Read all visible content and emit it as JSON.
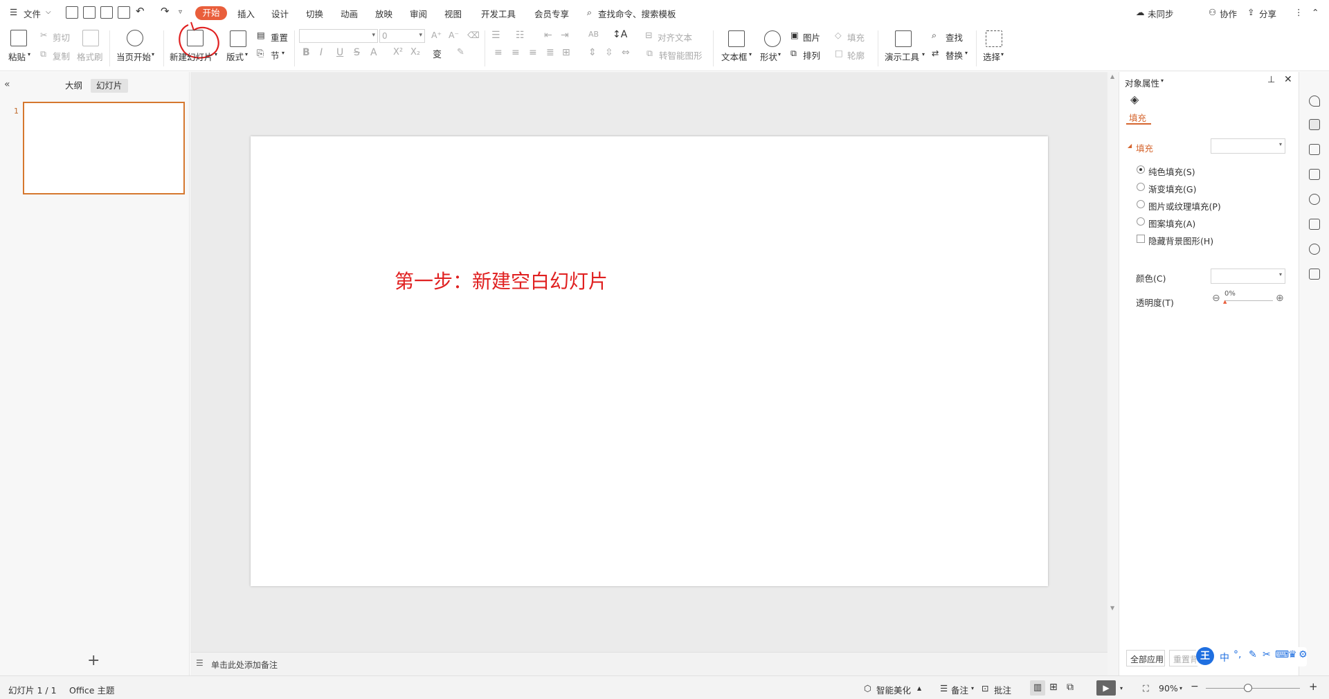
{
  "menubar": {
    "file": "文件",
    "tabs": [
      "开始",
      "插入",
      "设计",
      "切换",
      "动画",
      "放映",
      "审阅",
      "视图",
      "开发工具",
      "会员专享"
    ],
    "search_placeholder": "查找命令、搜索模板",
    "unsynced": "未同步",
    "collab": "协作",
    "share": "分享"
  },
  "ribbon": {
    "paste": "粘贴",
    "cut": "剪切",
    "copy": "复制",
    "format_painter": "格式刷",
    "play_from_current": "当页开始",
    "new_slide": "新建幻灯片",
    "layout": "版式",
    "reset": "重置",
    "section": "节",
    "font_size": "0",
    "align_text": "对齐文本",
    "convert_smartart": "转智能图形",
    "textbox": "文本框",
    "shape": "形状",
    "picture": "图片",
    "fill": "填充",
    "arrange": "排列",
    "outline": "轮廓",
    "presentation_tools": "演示工具",
    "find": "查找",
    "replace": "替换",
    "select": "选择"
  },
  "leftpane": {
    "tab_outline": "大纲",
    "tab_slides": "幻灯片",
    "slide_number": "1"
  },
  "slide": {
    "text": "第一步：新建空白幻灯片"
  },
  "notes": {
    "placeholder": "单击此处添加备注"
  },
  "props": {
    "title": "对象属性",
    "tab_fill": "填充",
    "section_fill": "填充",
    "solid_fill": "纯色填充(S)",
    "gradient_fill": "渐变填充(G)",
    "picture_texture_fill": "图片或纹理填充(P)",
    "pattern_fill": "图案填充(A)",
    "hide_bg_graphics": "隐藏背景图形(H)",
    "color_label": "颜色(C)",
    "transparency_label": "透明度(T)",
    "transparency_value": "0%",
    "apply_all": "全部应用",
    "reset_bg": "重置背景"
  },
  "statusbar": {
    "slide_info": "幻灯片 1 / 1",
    "theme": "Office 主题",
    "smart_beautify": "智能美化",
    "notes": "备注",
    "comments": "批注",
    "zoom": "90%"
  },
  "ime": {
    "lang": "中"
  },
  "colors": {
    "accent": "#e95e3b",
    "slide_text": "#e02020",
    "thumb_border": "#d5772e"
  }
}
